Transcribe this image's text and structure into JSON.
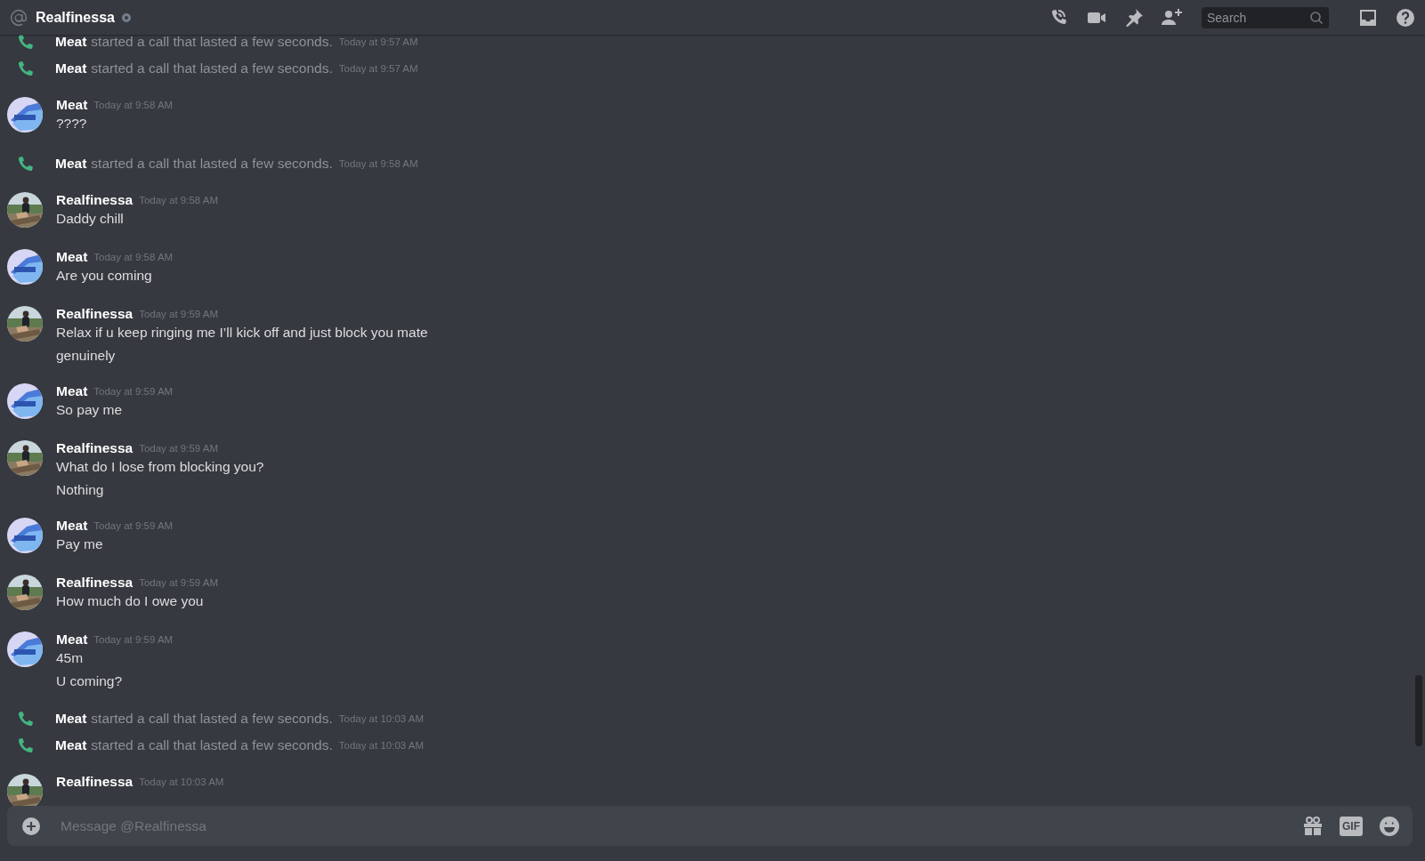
{
  "header": {
    "title": "Realfinessa",
    "online": false,
    "search": {
      "placeholder": "Search"
    }
  },
  "messages": [
    {
      "kind": "call",
      "author": "Meat",
      "text": "started a call that lasted a few seconds.",
      "time": "Today at 9:57 AM"
    },
    {
      "kind": "call",
      "author": "Meat",
      "text": "started a call that lasted a few seconds.",
      "time": "Today at 9:57 AM"
    },
    {
      "kind": "group",
      "author": "Meat",
      "avatar": {
        "kind": "emblem"
      },
      "time": "Today at 9:58 AM",
      "lines": [
        "????"
      ]
    },
    {
      "kind": "call",
      "author": "Meat",
      "text": "started a call that lasted a few seconds.",
      "time": "Today at 9:58 AM"
    },
    {
      "kind": "group",
      "author": "Realfinessa",
      "avatar": {
        "kind": "photo"
      },
      "time": "Today at 9:58 AM",
      "lines": [
        "Daddy chill"
      ]
    },
    {
      "kind": "group",
      "author": "Meat",
      "avatar": {
        "kind": "emblem"
      },
      "time": "Today at 9:58 AM",
      "lines": [
        "Are you coming"
      ]
    },
    {
      "kind": "group",
      "author": "Realfinessa",
      "avatar": {
        "kind": "photo"
      },
      "time": "Today at 9:59 AM",
      "lines": [
        "Relax if u keep ringing me I’ll kick off and just block you mate",
        "genuinely"
      ]
    },
    {
      "kind": "group",
      "author": "Meat",
      "avatar": {
        "kind": "emblem"
      },
      "time": "Today at 9:59 AM",
      "lines": [
        "So pay me"
      ]
    },
    {
      "kind": "group",
      "author": "Realfinessa",
      "avatar": {
        "kind": "photo"
      },
      "time": "Today at 9:59 AM",
      "lines": [
        "What do I lose from blocking you?",
        "Nothing"
      ]
    },
    {
      "kind": "group",
      "author": "Meat",
      "avatar": {
        "kind": "emblem"
      },
      "time": "Today at 9:59 AM",
      "lines": [
        "Pay me"
      ]
    },
    {
      "kind": "group",
      "author": "Realfinessa",
      "avatar": {
        "kind": "photo"
      },
      "time": "Today at 9:59 AM",
      "lines": [
        "How much do I owe you"
      ]
    },
    {
      "kind": "group",
      "author": "Meat",
      "avatar": {
        "kind": "emblem"
      },
      "time": "Today at 9:59 AM",
      "lines": [
        "45m",
        "U coming?"
      ]
    },
    {
      "kind": "call",
      "author": "Meat",
      "text": "started a call that lasted a few seconds.",
      "time": "Today at 10:03 AM"
    },
    {
      "kind": "call",
      "author": "Meat",
      "text": "started a call that lasted a few seconds.",
      "time": "Today at 10:03 AM"
    },
    {
      "kind": "group",
      "author": "Realfinessa",
      "avatar": {
        "kind": "photo"
      },
      "time": "Today at 10:03 AM"
    }
  ],
  "composer": {
    "placeholder": "Message @Realfinessa",
    "gif_label": "GIF"
  }
}
